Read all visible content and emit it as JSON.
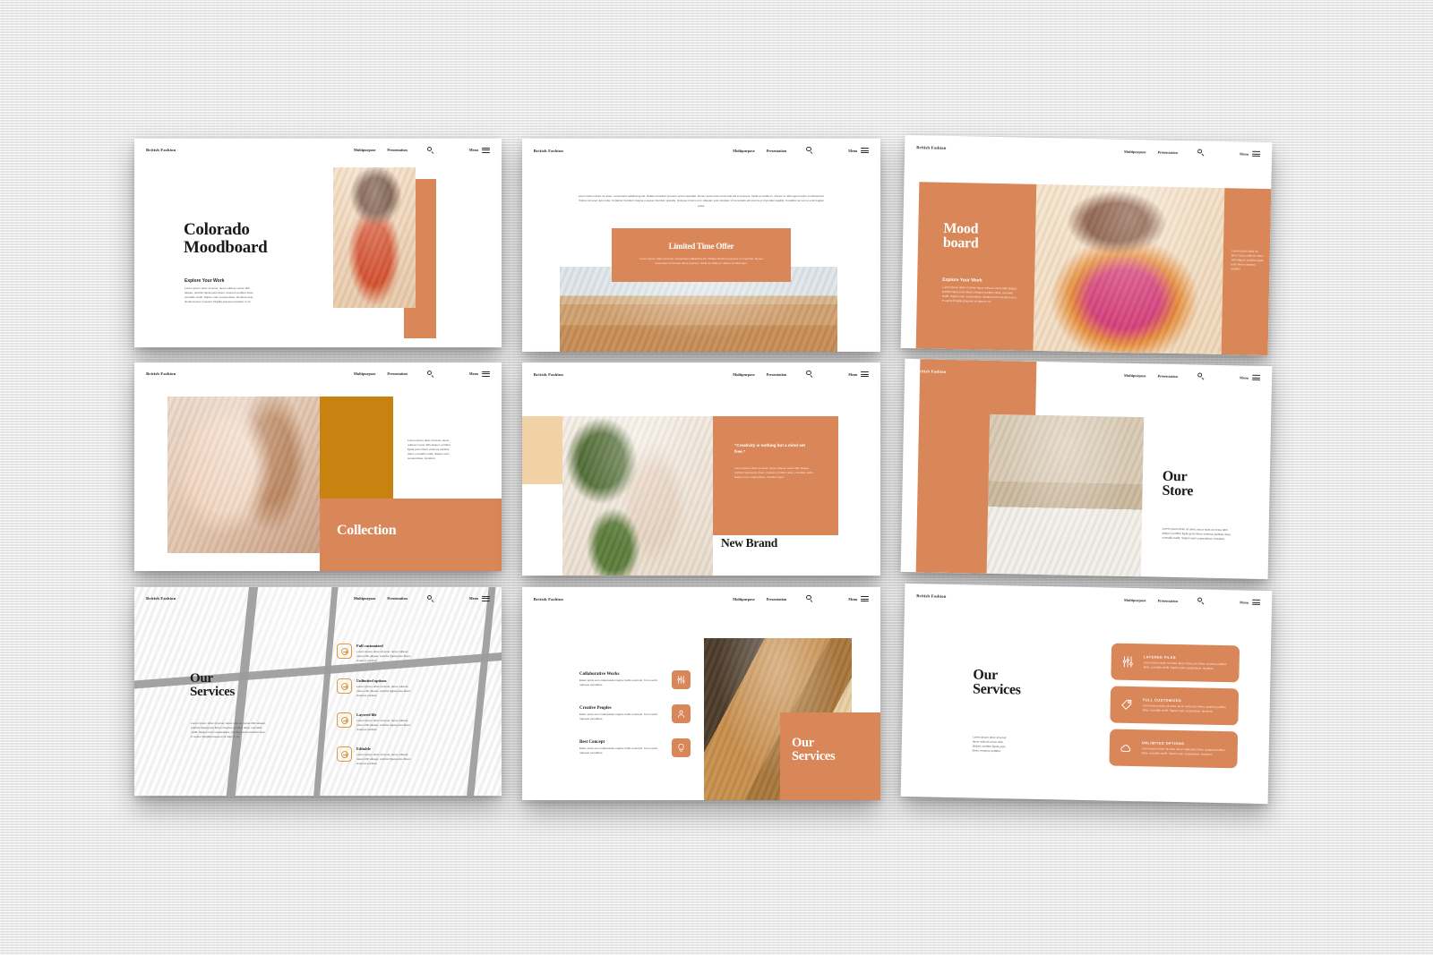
{
  "theme": {
    "backdrop": "#e8e8e8",
    "terracotta": "#d98658",
    "gold": "#c8820f",
    "tan": "#f0d2a6",
    "ink": "#1b1918"
  },
  "header": {
    "logo": "British Fashion",
    "nav": [
      "Multipurpose",
      "Presentation"
    ],
    "search_icon": "search-icon",
    "menu_label": "Menu",
    "menu_icon": "hamburger-icon"
  },
  "lorem": {
    "short": "Lorem ipsum dolor sit amet, lacus nulla ac netus nibh aliquet, porttitor ligula justo libero vivamus porttitor dolor, convallis mollit. Sapien nam suspendisse, tincidunt.",
    "medium": "Lorem ipsum dolor sit amet, lacus nulla ac netus nibh aliquet, porttitor ligula justo libero vivamus porttitor dolor, convallis mollit. Sapien nam suspendisse, tincidunt ante tincidunt arcu in auctor fringilla praesent sit diam in sit.",
    "tiny": "Lorem ipsum dolor sit amet, lacus nulla ac netus nibh aliquet, porttitor ligula justo libero vivamus porttitor.",
    "paragraph": "Lorem ipsum dolor sit amet, consectetur adipiscing elit. Nullam tincidunt posuere enim imperdiet. Donec accumsan commodo elit et posuere. Nulla at mattis ex. Donec ut nibh eget mauris condimentum finibus sit amet quis nulla. Curabitur tincidunt magna a augue interdum gravida. Quisque id arcu orci. Aliquam erat volutpat. Ut venenatis elit viverra et imperdiet sagittis. Curabitur ac sem a erat feugiat porta.",
    "offer_body": "Lorem ipsum dolor sit amet, consectetur adipiscing elit. Nullam tincidunt posuere in imperdiet. Donec accumsan commodo elit et posuere. Nulla at mattis ex. Donec ut nibh eget.",
    "quote_body": "Lorem ipsum dolor sit amet, lacus nulla ac netus nibh aliquet, porttitor ligula justo libero vivamus porttitor dolor, convallis mollit. Sapien nam suspendisse, tincidunt eget.",
    "services_body": "Etiam porta sem malesuada magna mollis euismod. Cum sociis natoque penatibus.",
    "card_body": "Lorem ipsum dolor sit amet, lacus nulla justo libero vivamus porttitor dolor, convallis mollit. Sapien nam suspendisse, tincidunt."
  },
  "slides": [
    {
      "id": "slide-colorado-moodboard",
      "title": "Colorado\nMoodboard",
      "title_line1": "Colorado",
      "title_line2": "Moodboard",
      "subhead": "Explore Your Work"
    },
    {
      "id": "slide-limited-time-offer",
      "title": "Limited Time Offer"
    },
    {
      "id": "slide-mood-board",
      "title_line1": "Mood",
      "title_line2": "board",
      "subhead": "Explore Your Work"
    },
    {
      "id": "slide-collection",
      "title": "Collection"
    },
    {
      "id": "slide-new-brand",
      "title": "New Brand",
      "quote": "“Creativity is nothing but a mind set free.”"
    },
    {
      "id": "slide-our-store",
      "title_line1": "Our",
      "title_line2": "Store"
    },
    {
      "id": "slide-our-services-list",
      "title_line1": "Our",
      "title_line2": "Services",
      "items": [
        {
          "label": "Full customized",
          "icon": "arrow-circle-icon"
        },
        {
          "label": "Unlimited options",
          "icon": "arrow-circle-icon"
        },
        {
          "label": "Layered file",
          "icon": "arrow-circle-icon"
        },
        {
          "label": "Editable",
          "icon": "arrow-circle-icon"
        }
      ]
    },
    {
      "id": "slide-our-services-icons",
      "title_line1": "Our",
      "title_line2": "Services",
      "items": [
        {
          "label": "Collaborative Works",
          "icon": "sliders-icon"
        },
        {
          "label": "Creative Peoples",
          "icon": "user-icon"
        },
        {
          "label": "Best Concept",
          "icon": "lightbulb-icon"
        }
      ]
    },
    {
      "id": "slide-our-services-cards",
      "title_line1": "Our",
      "title_line2": "Services",
      "items": [
        {
          "label": "LAYERED FILES",
          "icon": "sliders-icon"
        },
        {
          "label": "FULL CUSTOMIZED",
          "icon": "tag-icon"
        },
        {
          "label": "UNLIMITED OPTIONS",
          "icon": "cloud-icon"
        }
      ]
    }
  ]
}
